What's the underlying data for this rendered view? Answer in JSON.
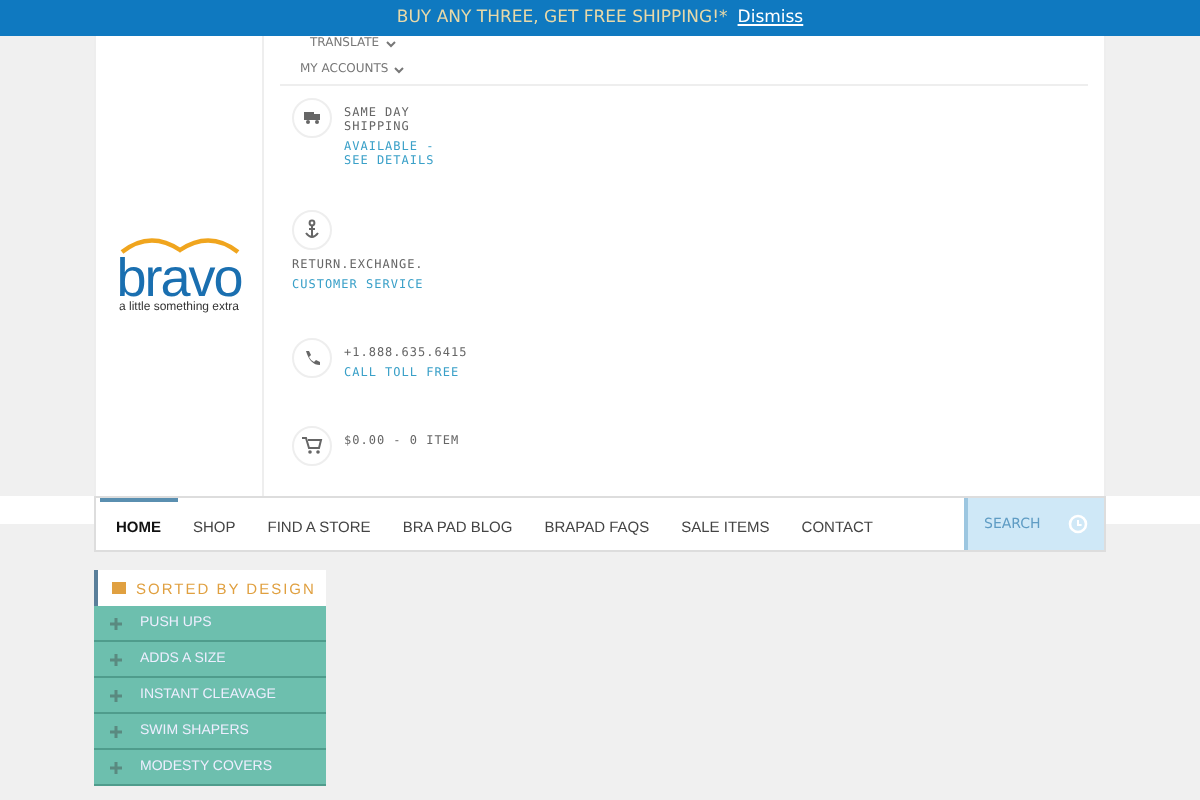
{
  "promo_bar": {
    "text": "BUY ANY THREE, GET FREE SHIPPING!*",
    "link": "Dismiss"
  },
  "header": {
    "logo": {
      "wordmark": "bravo",
      "tagline": "a little something extra"
    },
    "top_links": [
      {
        "label": "TRANSLATE"
      },
      {
        "label": "MY ACCOUNTS"
      }
    ],
    "info_items": [
      {
        "kind": "truck",
        "title": "SAME DAY SHIPPING",
        "link": "AVAILABLE - SEE DETAILS"
      },
      {
        "kind": "anchor",
        "title": "RETURN.EXCHANGE.",
        "link": "CUSTOMER SERVICE"
      },
      {
        "kind": "phone",
        "title": "+1.888.635.6415",
        "link": "CALL TOLL FREE"
      },
      {
        "kind": "cart",
        "title": "$0.00 - 0 ITEM"
      }
    ]
  },
  "nav": {
    "items": [
      {
        "label": "HOME",
        "selected": true
      },
      {
        "label": "SHOP",
        "selected": false
      },
      {
        "label": "FIND A STORE",
        "selected": false
      },
      {
        "label": "BRA PAD BLOG",
        "selected": false
      },
      {
        "label": "BRAPAD FAQS",
        "selected": false
      },
      {
        "label": "SALE ITEMS",
        "selected": false
      },
      {
        "label": "CONTACT",
        "selected": false
      }
    ],
    "search": {
      "placeholder": "SEARCH"
    }
  },
  "sidebar": {
    "title": "SORTED BY DESIGN",
    "items": [
      {
        "label": "PUSH UPS"
      },
      {
        "label": "ADDS A SIZE"
      },
      {
        "label": "INSTANT CLEAVAGE"
      },
      {
        "label": "SWIM SHAPERS"
      },
      {
        "label": "MODESTY COVERS"
      }
    ]
  }
}
